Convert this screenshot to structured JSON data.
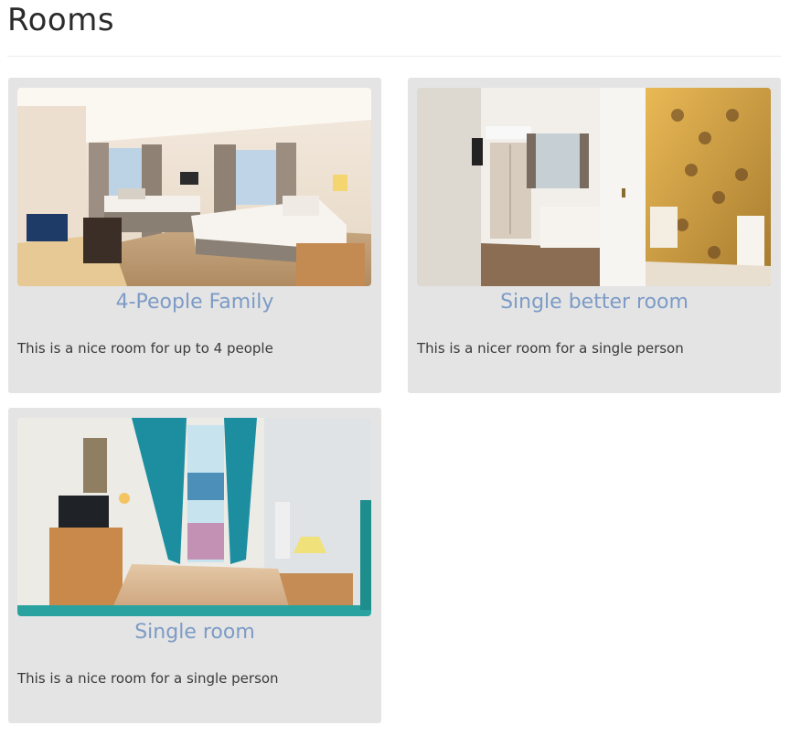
{
  "page": {
    "title": "Rooms"
  },
  "rooms": [
    {
      "name": "4-People Family",
      "description": "This is a nice room for up to 4 people",
      "image_alt": "hotel-room-photo"
    },
    {
      "name": "Single better room",
      "description": "This is a nicer room for a single person",
      "image_alt": "hotel-room-photo"
    },
    {
      "name": "Single room",
      "description": "This is a nice room for a single person",
      "image_alt": "hotel-room-photo"
    }
  ],
  "colors": {
    "card_background": "#e4e4e4",
    "room_name": "#7c9bc6",
    "text": "#3a3a3a"
  }
}
